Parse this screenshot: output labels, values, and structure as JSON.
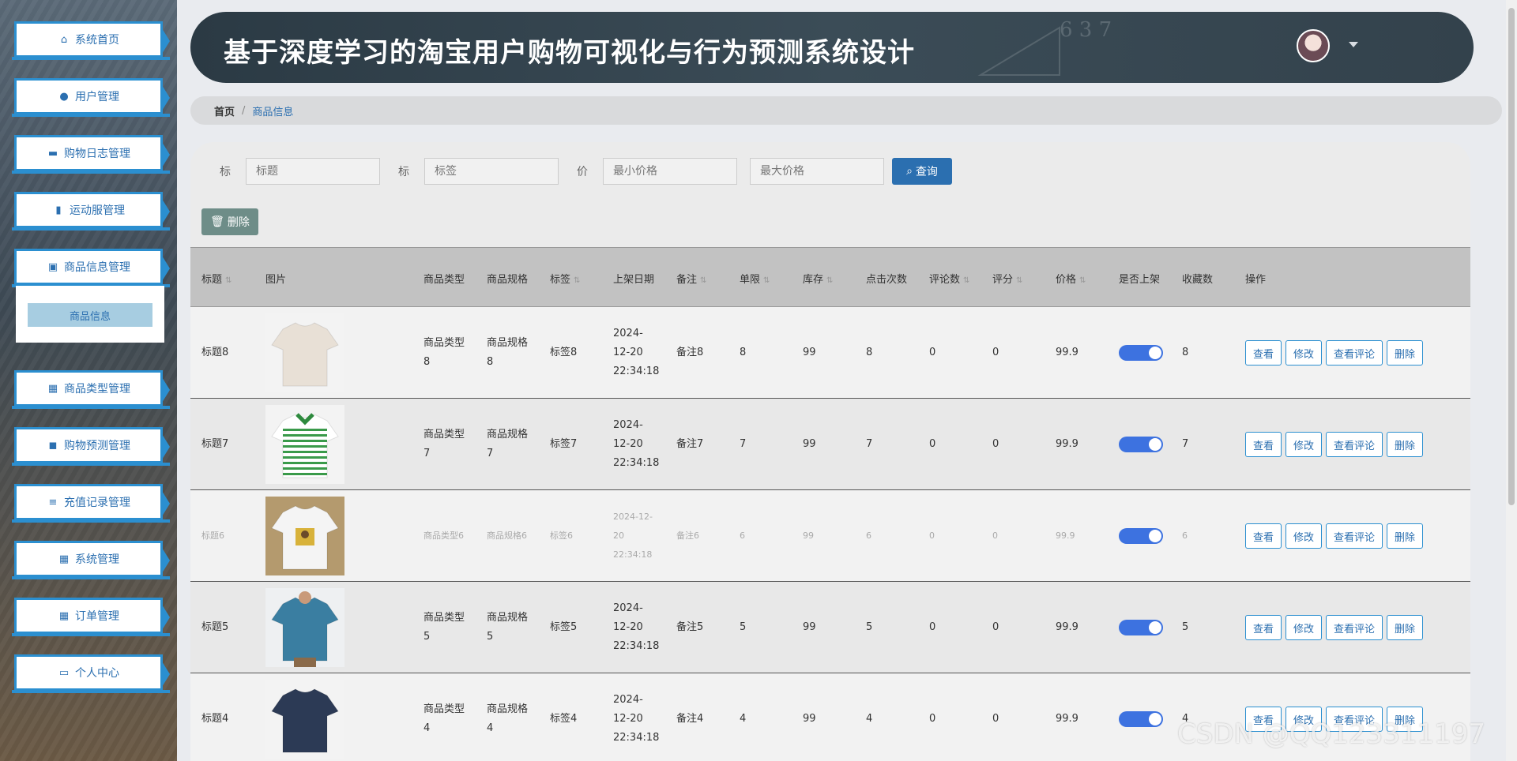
{
  "sidebar": {
    "items": [
      {
        "label": "系统首页",
        "icon": "home-icon"
      },
      {
        "label": "用户管理",
        "icon": "user-icon"
      },
      {
        "label": "购物日志管理",
        "icon": "monitor-icon"
      },
      {
        "label": "运动服管理",
        "icon": "book-icon"
      },
      {
        "label": "商品信息管理",
        "icon": "clipboard-icon"
      },
      {
        "label": "商品类型管理",
        "icon": "grid-icon"
      },
      {
        "label": "购物预测管理",
        "icon": "chat-icon"
      },
      {
        "label": "充值记录管理",
        "icon": "sliders-icon"
      },
      {
        "label": "系统管理",
        "icon": "grid-icon"
      },
      {
        "label": "订单管理",
        "icon": "grid-icon"
      },
      {
        "label": "个人中心",
        "icon": "card-icon"
      }
    ],
    "submenu": {
      "label": "商品信息"
    }
  },
  "header": {
    "title": "基于深度学习的淘宝用户购物可视化与行为预测系统设计",
    "chalk": "6 3 7"
  },
  "breadcrumb": {
    "home": "首页",
    "sep": "/",
    "current": "商品信息"
  },
  "search": {
    "label1": "标",
    "placeholder1": "标题",
    "label2": "标",
    "placeholder2": "标签",
    "label3": "价",
    "placeholder_min": "最小价格",
    "placeholder_max": "最大价格",
    "button": "查询"
  },
  "toolbar": {
    "delete": "删除"
  },
  "table": {
    "headers": [
      "标题",
      "图片",
      "商品类型",
      "商品规格",
      "标签",
      "上架日期",
      "备注",
      "单限",
      "库存",
      "点击次数",
      "评论数",
      "评分",
      "价格",
      "是否上架",
      "收藏数",
      "操作"
    ],
    "ops": [
      "查看",
      "修改",
      "查看评论",
      "删除"
    ],
    "rows": [
      {
        "title": "标题8",
        "type": "商品类型8",
        "spec": "商品规格8",
        "tag": "标签8",
        "date": "2024-12-20 22:34:18",
        "note": "备注8",
        "limit": "8",
        "stock": "99",
        "clicks": "8",
        "comments": "0",
        "score": "0",
        "price": "99.9",
        "online": true,
        "fav": "8",
        "img": "beige-tshirt"
      },
      {
        "title": "标题7",
        "type": "商品类型7",
        "spec": "商品规格7",
        "tag": "标签7",
        "date": "2024-12-20 22:34:18",
        "note": "备注7",
        "limit": "7",
        "stock": "99",
        "clicks": "7",
        "comments": "0",
        "score": "0",
        "price": "99.9",
        "online": true,
        "fav": "7",
        "img": "green-striped-polo"
      },
      {
        "title": "标题6",
        "type": "商品类型6",
        "spec": "商品规格6",
        "tag": "标签6",
        "date": "2024-12-20 22:34:18",
        "note": "备注6",
        "limit": "6",
        "stock": "99",
        "clicks": "6",
        "comments": "0",
        "score": "0",
        "price": "99.9",
        "online": true,
        "fav": "6",
        "img": "white-graphic-tee"
      },
      {
        "title": "标题5",
        "type": "商品类型5",
        "spec": "商品规格5",
        "tag": "标签5",
        "date": "2024-12-20 22:34:18",
        "note": "备注5",
        "limit": "5",
        "stock": "99",
        "clicks": "5",
        "comments": "0",
        "score": "0",
        "price": "99.9",
        "online": true,
        "fav": "5",
        "img": "blue-tee-model"
      },
      {
        "title": "标题4",
        "type": "商品类型4",
        "spec": "商品规格4",
        "tag": "标签4",
        "date": "2024-12-20 22:34:18",
        "note": "备注4",
        "limit": "4",
        "stock": "99",
        "clicks": "4",
        "comments": "0",
        "score": "0",
        "price": "99.9",
        "online": true,
        "fav": "4",
        "img": "navy-tee"
      }
    ]
  },
  "watermark": "CSDN @QQ123311197",
  "colors": {
    "accent": "#2b6fb0",
    "border": "#2b8fd0",
    "toggle": "#3d72e0",
    "delete_btn": "#6e8d88"
  }
}
